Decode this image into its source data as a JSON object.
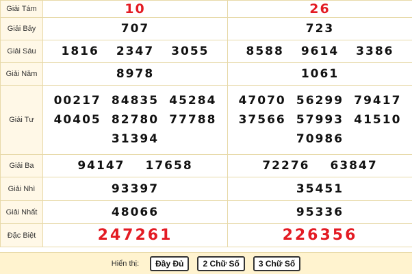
{
  "rows": [
    {
      "label": "Giải Tám",
      "left": [
        "10"
      ],
      "right": [
        "26"
      ]
    },
    {
      "label": "Giải Bảy",
      "left": [
        "707"
      ],
      "right": [
        "723"
      ]
    },
    {
      "label": "Giải Sáu",
      "left": [
        "1816",
        "2347",
        "3055"
      ],
      "right": [
        "8588",
        "9614",
        "3386"
      ]
    },
    {
      "label": "Giải Năm",
      "left": [
        "8978"
      ],
      "right": [
        "1061"
      ]
    },
    {
      "label": "Giải Tư",
      "left": [
        "00217",
        "84835",
        "45284",
        "40405",
        "82780",
        "77788",
        "31394"
      ],
      "right": [
        "47070",
        "56299",
        "79417",
        "37566",
        "57993",
        "41510",
        "70986"
      ]
    },
    {
      "label": "Giải Ba",
      "left": [
        "94147",
        "17658"
      ],
      "right": [
        "72276",
        "63847"
      ]
    },
    {
      "label": "Giải Nhì",
      "left": [
        "93397"
      ],
      "right": [
        "35451"
      ]
    },
    {
      "label": "Giải Nhất",
      "left": [
        "48066"
      ],
      "right": [
        "95336"
      ]
    },
    {
      "label": "Đặc Biệt",
      "left": [
        "247261"
      ],
      "right": [
        "226356"
      ]
    }
  ],
  "footer": {
    "label": "Hiển thị:",
    "buttons": [
      "Đầy Đủ",
      "2 Chữ Số",
      "3 Chữ Số"
    ]
  },
  "colors": {
    "prize_red": "#e31b23",
    "label_bg": "#fff8e7",
    "border": "#e7d9a8"
  }
}
